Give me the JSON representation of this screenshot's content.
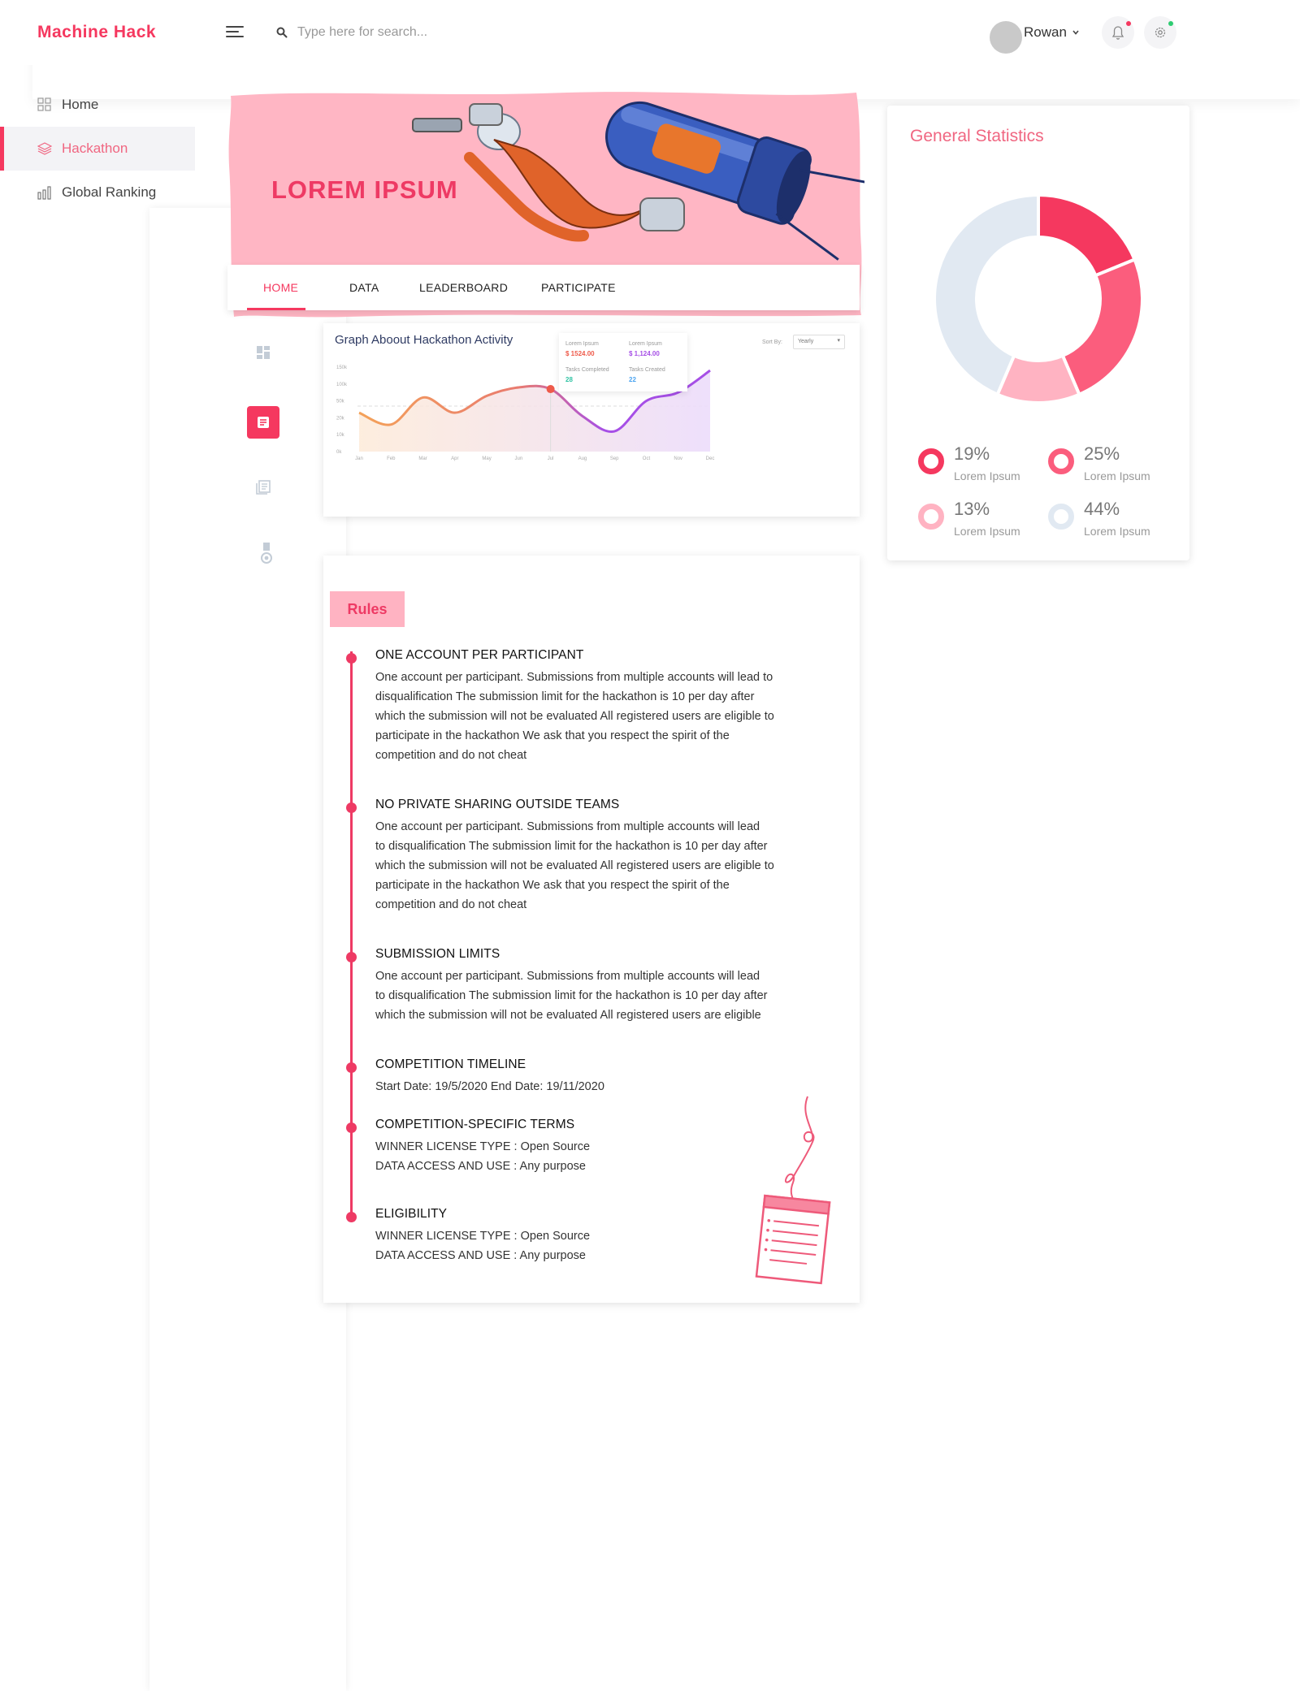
{
  "header": {
    "logo": "Machine Hack",
    "search_placeholder": "Type here for search...",
    "user_name": "Rowan",
    "icons": [
      "menu-icon",
      "search-icon",
      "chevron-down-icon",
      "bell-icon",
      "gear-icon"
    ],
    "notification_dot_colors": {
      "bell": "#f5385f",
      "gear": "#2ecc71"
    }
  },
  "sidebar": {
    "items": [
      {
        "label": "Home",
        "icon": "grid-icon",
        "active": false
      },
      {
        "label": "Hackathon",
        "icon": "layers-icon",
        "active": true
      },
      {
        "label": "Global Ranking",
        "icon": "bar-chart-icon",
        "active": false
      }
    ]
  },
  "banner": {
    "title": "LOREM IPSUM",
    "background_color": "#ffb6c4"
  },
  "tabs": [
    {
      "label": "HOME",
      "active": true
    },
    {
      "label": "DATA",
      "active": false
    },
    {
      "label": "LEADERBOARD",
      "active": false
    },
    {
      "label": "PARTICIPATE",
      "active": false
    }
  ],
  "side_strip": {
    "icons": [
      "dashboard-icon",
      "document-icon",
      "library-icon",
      "medal-icon"
    ],
    "active_index": 1
  },
  "activity_chart": {
    "title": "Graph Aboout Hackathon Activity",
    "sort_label": "Sort By:",
    "sort_value": "Yearly",
    "tooltip": {
      "col1_label": "Lorem Ipsum",
      "col1_value": "$ 1524.00",
      "col2_label": "Lorem Ipsum",
      "col2_value": "$ 1,124.00",
      "col1_sub_label": "Tasks Completed",
      "col1_sub_value": "28",
      "col2_sub_label": "Tasks Created",
      "col2_sub_value": "22"
    }
  },
  "chart_data": [
    {
      "type": "line",
      "title": "Graph Aboout Hackathon Activity",
      "categories": [
        "Jan",
        "Feb",
        "Mar",
        "Apr",
        "May",
        "Jun",
        "Jul",
        "Aug",
        "Sep",
        "Oct",
        "Nov",
        "Dec"
      ],
      "y_tick_labels": [
        "0k",
        "10k",
        "20k",
        "50k",
        "100k",
        "150k"
      ],
      "values": [
        2.3,
        1.6,
        3.2,
        2.3,
        3.3,
        3.8,
        3.7,
        2.1,
        1.2,
        3.0,
        3.5,
        4.8
      ],
      "ylim": [
        0,
        5
      ],
      "highlight_index": 6,
      "grid": false,
      "colors": {
        "start": "#f4a259",
        "end": "#a64fe6",
        "marker": "#ee5a4a"
      }
    },
    {
      "type": "pie",
      "title": "General Statistics",
      "series": [
        {
          "name": "Lorem Ipsum",
          "value": 19,
          "color": "#f5385f"
        },
        {
          "name": "Lorem Ipsum",
          "value": 25,
          "color": "#fb5d7d"
        },
        {
          "name": "Lorem Ipsum",
          "value": 13,
          "color": "#ffb3c2"
        },
        {
          "name": "Lorem Ipsum",
          "value": 44,
          "color": "#e1e9f2"
        }
      ]
    }
  ],
  "stats": {
    "title": "General Statistics",
    "legend": [
      {
        "pct": "19%",
        "label": "Lorem Ipsum",
        "color": "#f5385f"
      },
      {
        "pct": "25%",
        "label": "Lorem Ipsum",
        "color": "#fb5d7d"
      },
      {
        "pct": "13%",
        "label": "Lorem Ipsum",
        "color": "#ffb3c2"
      },
      {
        "pct": "44%",
        "label": "Lorem Ipsum",
        "color": "#e1e9f2"
      }
    ]
  },
  "rules": {
    "badge": "Rules",
    "items": [
      {
        "title": "ONE ACCOUNT PER PARTICIPANT",
        "lines": [
          "One account per participant. Submissions from multiple accounts will lead to",
          "disqualification The submission limit for the hackathon is 10 per day after",
          "which the submission will not be evaluated All registered users are eligible to",
          "participate in the hackathon We ask that you respect the spirit of the",
          "competition and do not cheat"
        ]
      },
      {
        "title": "NO PRIVATE SHARING OUTSIDE TEAMS",
        "lines": [
          "One account per participant. Submissions from multiple accounts will lead",
          "to disqualification The submission limit for the hackathon is 10 per day after",
          "which the submission will not be evaluated All registered users are eligible to",
          "participate in the hackathon We ask that you respect the spirit of the",
          "competition and do not cheat"
        ]
      },
      {
        "title": "SUBMISSION LIMITS",
        "lines": [
          "One account per participant. Submissions from multiple accounts will lead",
          "to disqualification The submission limit for the hackathon is 10 per day after",
          "which the submission will not be evaluated All registered users are eligible"
        ]
      },
      {
        "title": "COMPETITION TIMELINE",
        "lines": [
          "Start Date: 19/5/2020 End Date: 19/11/2020"
        ]
      },
      {
        "title": "COMPETITION-SPECIFIC TERMS",
        "lines": [
          "WINNER LICENSE TYPE : Open Source",
          "DATA ACCESS AND USE : Any purpose"
        ]
      },
      {
        "title": "ELIGIBILITY",
        "lines": [
          "WINNER LICENSE TYPE : Open Source",
          "DATA ACCESS AND USE : Any purpose"
        ]
      }
    ]
  }
}
